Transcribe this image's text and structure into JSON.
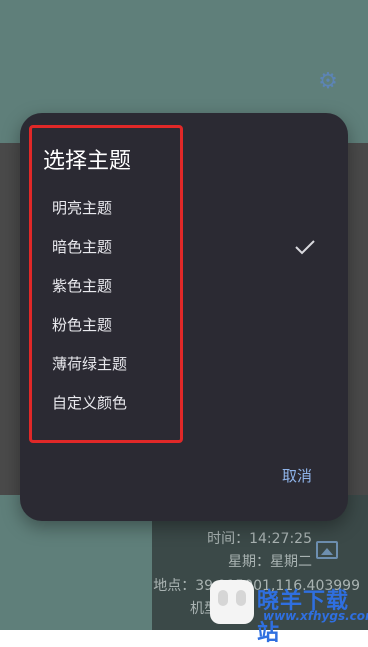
{
  "background": {
    "info": {
      "time_text": "时间：14:27:25",
      "weekday_text": "星期：星期二",
      "location_text": "地点：39.915001,116.403999",
      "model_text": "机型"
    },
    "icons": {
      "settings": "gear-icon",
      "gallery": "gallery-icon"
    }
  },
  "dialog": {
    "title": "选择主题",
    "options": [
      {
        "label": "明亮主题",
        "selected": false
      },
      {
        "label": "暗色主题",
        "selected": true
      },
      {
        "label": "紫色主题",
        "selected": false
      },
      {
        "label": "粉色主题",
        "selected": false
      },
      {
        "label": "薄荷绿主题",
        "selected": false
      },
      {
        "label": "自定义颜色",
        "selected": false
      }
    ],
    "cancel_label": "取消"
  },
  "watermark": {
    "name": "晓羊下载站",
    "url": "www.xfhygs.com"
  },
  "colors": {
    "dialog_bg": "#2b2a33",
    "accent": "#8fb4ea",
    "annotation": "#e02828",
    "teal_bg": "#5f7f7a"
  }
}
